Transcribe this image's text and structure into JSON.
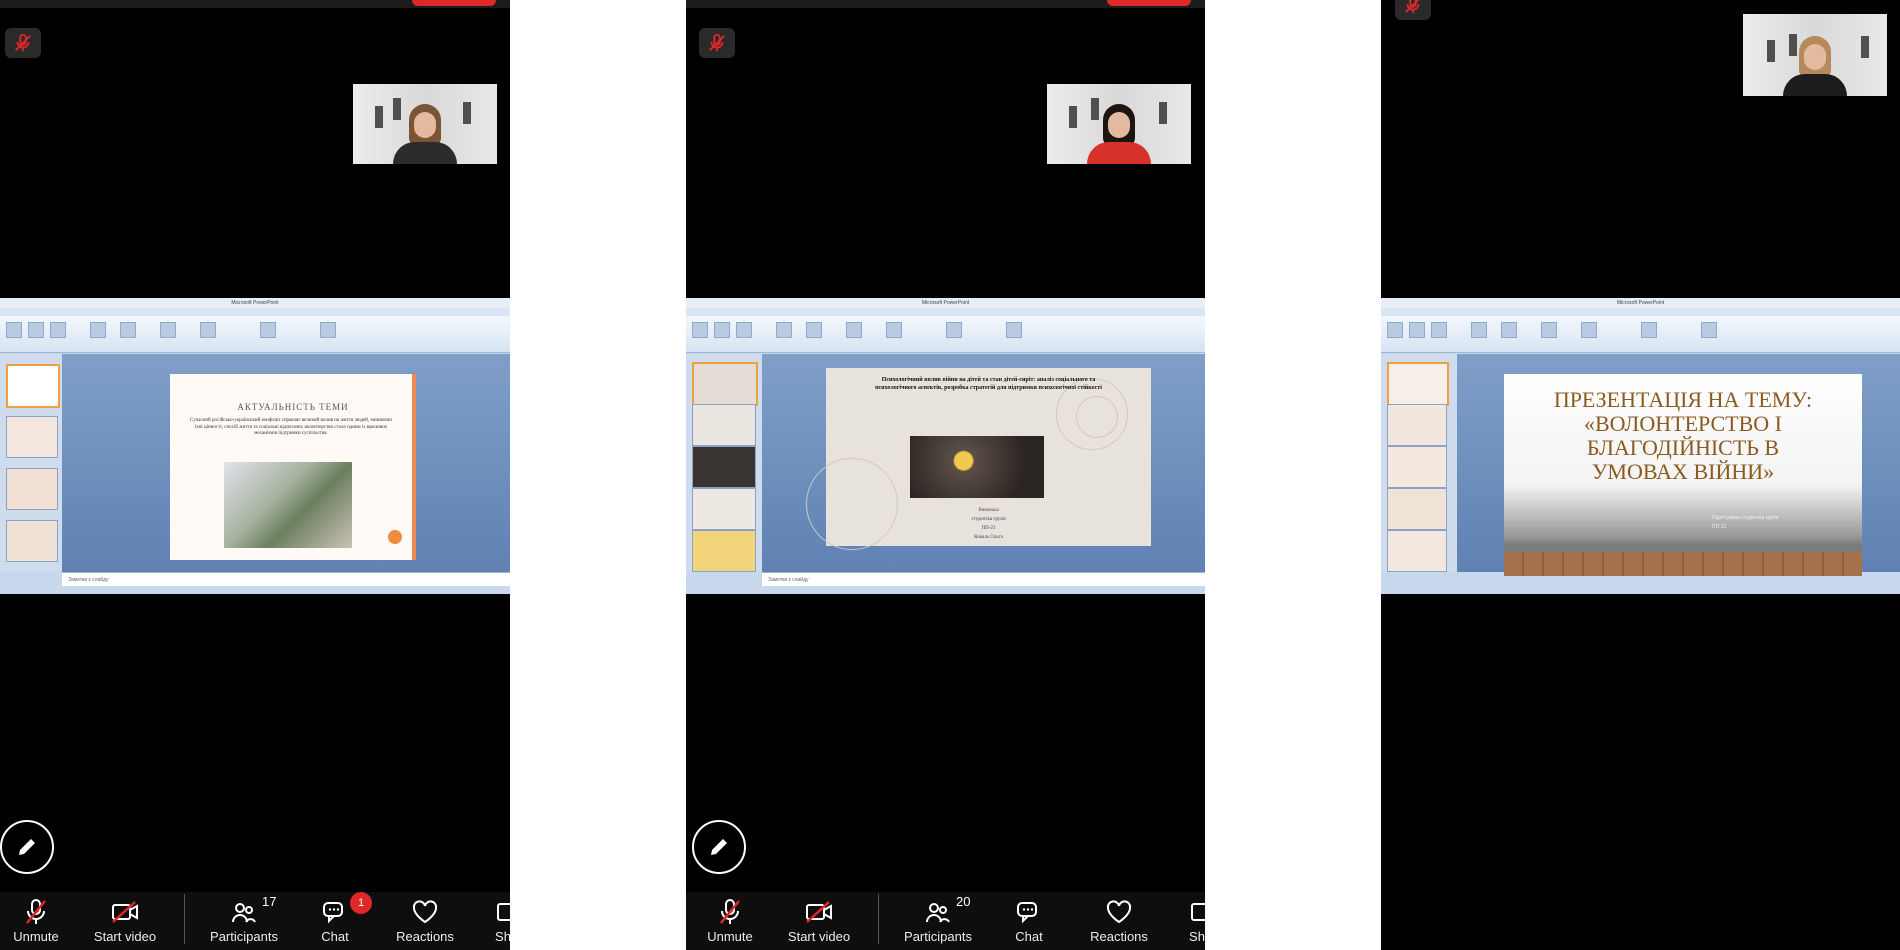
{
  "panels": [
    {
      "toolbar": {
        "unmute": "Unmute",
        "start_video": "Start video",
        "participants": "Participants",
        "participants_count": "17",
        "chat": "Chat",
        "chat_badge": "1",
        "reactions": "Reactions",
        "share_partial": "Sh"
      },
      "slide": {
        "title": "АКТУАЛЬНІСТЬ ТЕМИ",
        "body": "Сучасний російсько-український конфлікт справляє великий вплив на життя людей, змінюючи їхні цінності, спосіб життя та соціальні відносини; волонтерство стало одним із важливих механізмів підтримки суспільства."
      },
      "notes_placeholder": "Заметки к слайду"
    },
    {
      "toolbar": {
        "unmute": "Unmute",
        "start_video": "Start video",
        "participants": "Participants",
        "participants_count": "20",
        "chat": "Chat",
        "reactions": "Reactions",
        "share_partial": "Sh"
      },
      "slide": {
        "title": "Психологічний вплив війни на дітей та стан дітей-сиріт: аналіз соціального та психологічного аспектів, розробка стратегій для підтримки психологічної стійкості",
        "caption_lines": [
          "Виконала",
          "студентка групи",
          "ПП-21",
          "Коваль Ольга"
        ]
      },
      "notes_placeholder": "Заметки к слайду"
    },
    {
      "slide": {
        "title": "ПРЕЗЕНТАЦІЯ НА ТЕМУ: «ВОЛОНТЕРСТВО І БЛАГОДІЙНІСТЬ В УМОВАХ ВІЙНИ»",
        "subtitle_lines": [
          "Підготувала студентка групи",
          "ПП-21"
        ]
      }
    }
  ],
  "colors": {
    "end_button": "#e02828",
    "badge": "#e02828",
    "accent_orange": "#f28c3c",
    "slide3_title": "#8b5a1e"
  },
  "icons": [
    "mic-off-icon",
    "video-off-icon",
    "participants-icon",
    "chat-icon",
    "heart-icon",
    "pencil-icon",
    "share-icon"
  ]
}
